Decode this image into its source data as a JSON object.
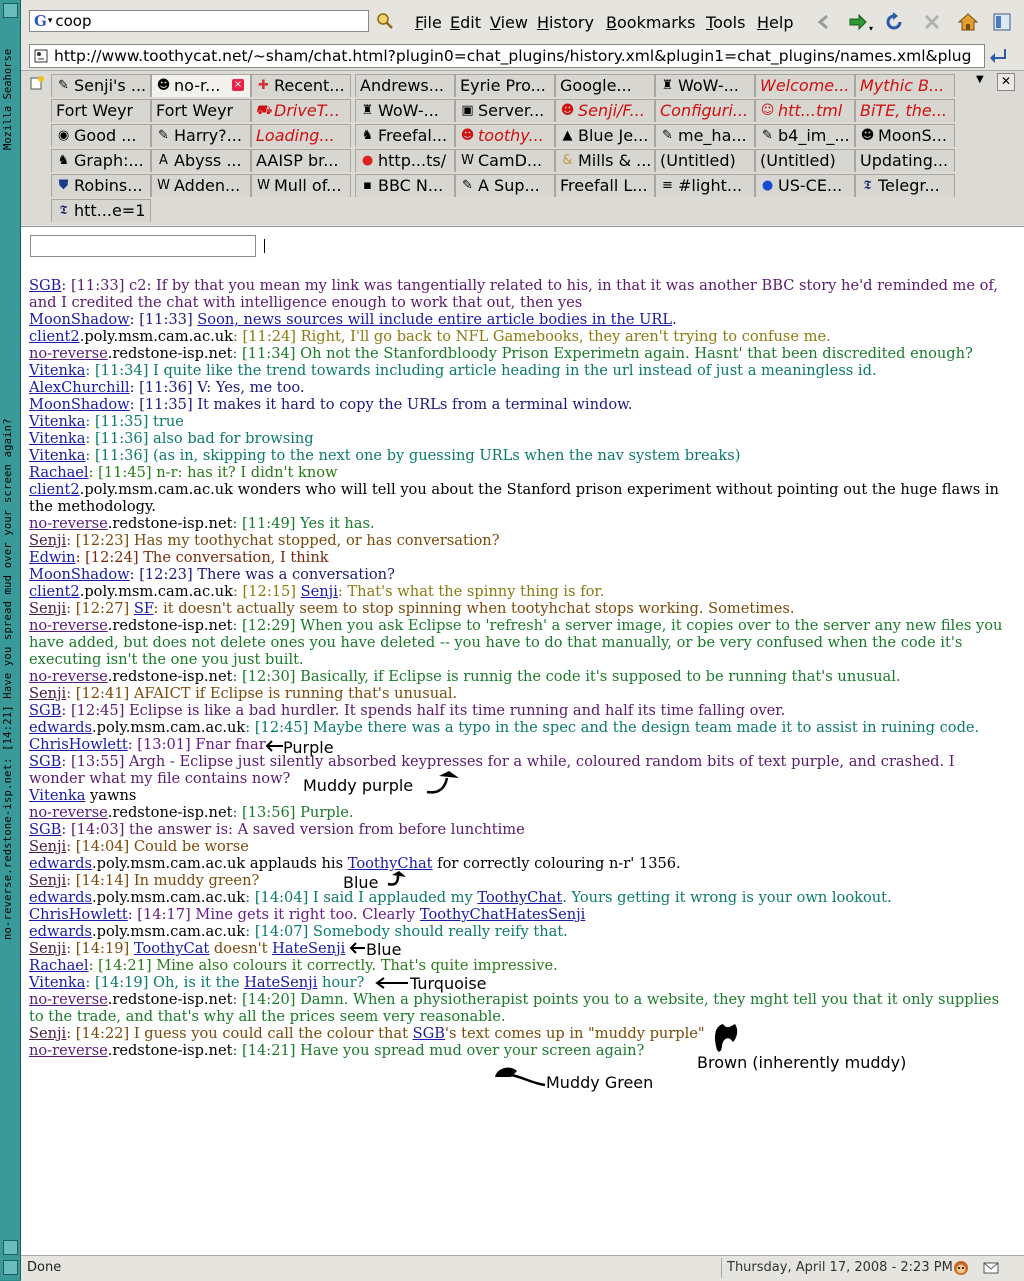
{
  "window": {
    "sidebar_title": "no-reverse.redstone-isp.net: [14:21] Have you spread mud over your screen again?",
    "sidebar_app": "Mozilla Seahorse"
  },
  "menubar": {
    "search_value": "coop",
    "search_engine_glyph": "G",
    "items": [
      "File",
      "Edit",
      "View",
      "History",
      "Bookmarks",
      "Tools",
      "Help"
    ]
  },
  "urlbar": {
    "url": "http://www.toothycat.net/~sham/chat.html?plugin0=chat_plugins/history.xml&plugin1=chat_plugins/names.xml&plug"
  },
  "tabs": {
    "rows": [
      [
        {
          "label": "Senji's ...",
          "icon": "pencil-icon",
          "red": false
        },
        {
          "label": "no-r...",
          "icon": "toothy-icon",
          "red": false,
          "active": true,
          "closable": true
        },
        {
          "label": "Recent...",
          "icon": "compass-icon",
          "red": false
        },
        {
          "label": "Andrews...",
          "icon": "",
          "red": false
        },
        {
          "label": "Eyrie Pro...",
          "icon": "",
          "red": false
        },
        {
          "label": "Google...",
          "icon": "",
          "red": false
        },
        {
          "label": "WoW-...",
          "icon": "wow-icon",
          "red": false
        },
        {
          "label": "Welcome...",
          "icon": "",
          "red": true
        },
        {
          "label": "Mythic B...",
          "icon": "",
          "red": true
        }
      ],
      [
        {
          "label": "Fort Weyr",
          "icon": "",
          "red": false
        },
        {
          "label": "Fort Weyr",
          "icon": "",
          "red": false
        },
        {
          "label": "DriveT...",
          "icon": "car-icon",
          "red": true
        },
        {
          "label": "WoW-...",
          "icon": "wow-icon",
          "red": false
        },
        {
          "label": "Server...",
          "icon": "server-icon",
          "red": false
        },
        {
          "label": "Senji/F...",
          "icon": "toothy-icon",
          "red": true
        },
        {
          "label": "Configuri...",
          "icon": "",
          "red": true
        },
        {
          "label": "htt...tml",
          "icon": "smiley-icon",
          "red": true
        },
        {
          "label": "BiTE, the...",
          "icon": "",
          "red": true
        }
      ],
      [
        {
          "label": "Good ...",
          "icon": "chat-icon",
          "red": false
        },
        {
          "label": "Harry?...",
          "icon": "pencil-icon",
          "red": false
        },
        {
          "label": "Loading...",
          "icon": "",
          "red": true
        },
        {
          "label": "Freefal...",
          "icon": "freefall-icon",
          "red": false
        },
        {
          "label": "toothy...",
          "icon": "toothy-icon",
          "red": true
        },
        {
          "label": "Blue Je...",
          "icon": "mountain-icon",
          "red": false
        },
        {
          "label": "me_ha...",
          "icon": "pencil-icon",
          "red": false
        },
        {
          "label": "b4_im_...",
          "icon": "pencil-icon",
          "red": false
        },
        {
          "label": "MoonS...",
          "icon": "toothy-icon",
          "red": false
        }
      ],
      [
        {
          "label": "Graph:...",
          "icon": "camel-icon",
          "red": false
        },
        {
          "label": "Abyss ...",
          "icon": "abyss-icon",
          "red": false
        },
        {
          "label": "AAISP br...",
          "icon": "",
          "red": false
        },
        {
          "label": "http...ts/",
          "icon": "color-ball-icon",
          "red": false
        },
        {
          "label": "CamD...",
          "icon": "camd-icon",
          "red": false
        },
        {
          "label": "Mills & ...",
          "icon": "ampersand-icon",
          "red": false
        },
        {
          "label": "(Untitled)",
          "icon": "",
          "red": false
        },
        {
          "label": "(Untitled)",
          "icon": "",
          "red": false
        },
        {
          "label": "Updating...",
          "icon": "",
          "red": false
        }
      ],
      [
        {
          "label": "Robins...",
          "icon": "shield-icon",
          "red": false
        },
        {
          "label": "Adden...",
          "icon": "wikipedia-icon",
          "red": false
        },
        {
          "label": "Mull of...",
          "icon": "wikipedia-icon",
          "red": false
        },
        {
          "label": "BBC N...",
          "icon": "bbc-icon",
          "red": false
        },
        {
          "label": "A Sup...",
          "icon": "pencil-icon",
          "red": false
        },
        {
          "label": "Freefall L...",
          "icon": "",
          "red": false
        },
        {
          "label": "#light...",
          "icon": "irc-icon",
          "red": false
        },
        {
          "label": "US-CE...",
          "icon": "blue-dot-icon",
          "red": false
        },
        {
          "label": "Telegr...",
          "icon": "telegraph-icon",
          "red": false
        }
      ],
      [
        {
          "label": "htt...e=1",
          "icon": "telegraph-icon",
          "red": false
        }
      ]
    ]
  },
  "chat": {
    "input_value": "",
    "messages": [
      {
        "segs": [
          {
            "t": "SGB",
            "nick": true
          },
          {
            "t": ": [11:33] c2: If by that you mean my link was tangentially related to his, in that it was another BBC story he'd reminded me of, and I credited the chat with intelligence enough to work that out, then yes"
          }
        ],
        "color": "#5a1a6e"
      },
      {
        "segs": [
          {
            "t": "MoonShadow",
            "nick": true
          },
          {
            "t": ": [11:33] "
          },
          {
            "t": "Soon, news sources will include entire article bodies in the URL",
            "link": true
          },
          {
            "t": "."
          }
        ],
        "color": "#1a1a7a"
      },
      {
        "segs": [
          {
            "t": "client2",
            "nick": true
          },
          {
            "t": ".poly.msm.cam.ac.uk",
            "plain": true
          },
          {
            "t": ": [11:24] Right, I'll go back to NFL Gamebooks, they aren't trying to confuse me."
          }
        ],
        "color": "#8a7a10"
      },
      {
        "segs": [
          {
            "t": "no-reverse",
            "nick": true,
            "cls": "purple"
          },
          {
            "t": ".redstone-isp.net",
            "plain": true
          },
          {
            "t": ": [11:34] Oh not the Stanfordbloody Prison Experimetn again. Hasnt' that been discredited enough?"
          }
        ],
        "color": "#1a7a2a"
      },
      {
        "segs": [
          {
            "t": "Vitenka",
            "nick": true
          },
          {
            "t": ": [11:34] I quite like the trend towards including article heading in the url instead of just a meaningless id."
          }
        ],
        "color": "#0a7a6a"
      },
      {
        "segs": [
          {
            "t": "AlexChurchill",
            "nick": true
          },
          {
            "t": ": [11:36] V: Yes, me too."
          }
        ],
        "color": "#1a1a7a"
      },
      {
        "segs": [
          {
            "t": "MoonShadow",
            "nick": true
          },
          {
            "t": ": [11:35] It makes it hard to copy the URLs from a terminal window."
          }
        ],
        "color": "#1a1a7a"
      },
      {
        "segs": [
          {
            "t": "Vitenka",
            "nick": true
          },
          {
            "t": ": [11:35] true"
          }
        ],
        "color": "#0a7a6a"
      },
      {
        "segs": [
          {
            "t": "Vitenka",
            "nick": true
          },
          {
            "t": ": [11:36] also bad for browsing"
          }
        ],
        "color": "#0a7a6a"
      },
      {
        "segs": [
          {
            "t": "Vitenka",
            "nick": true
          },
          {
            "t": ": [11:36] (as in, skipping to the next one by guessing URLs when the nav system breaks)"
          }
        ],
        "color": "#0a7a6a"
      },
      {
        "segs": [
          {
            "t": "Rachael",
            "nick": true
          },
          {
            "t": ": [11:45] n-r: has it? I didn't know"
          }
        ],
        "color": "#2a7a1a"
      },
      {
        "segs": [
          {
            "t": "client2",
            "nick": true
          },
          {
            "t": ".poly.msm.cam.ac.uk wonders who will tell you about the Stanford prison experiment without pointing out the huge flaws in the methodology."
          }
        ],
        "color": "#000000"
      },
      {
        "segs": [
          {
            "t": "no-reverse",
            "nick": true,
            "cls": "purple"
          },
          {
            "t": ".redstone-isp.net",
            "plain": true
          },
          {
            "t": ": [11:49] Yes it has."
          }
        ],
        "color": "#1a7a2a"
      },
      {
        "segs": [
          {
            "t": "Senji",
            "nick": true,
            "cls": "dark"
          },
          {
            "t": ": [12:23] Has my toothychat stopped, or has conversation?"
          }
        ],
        "color": "#7a4a0a"
      },
      {
        "segs": [
          {
            "t": "Edwin",
            "nick": true
          },
          {
            "t": ": [12:24] The conversation, I think"
          }
        ],
        "color": "#7a2a0a"
      },
      {
        "segs": [
          {
            "t": "MoonShadow",
            "nick": true
          },
          {
            "t": ": [12:23] There was a conversation?"
          }
        ],
        "color": "#1a1a7a"
      },
      {
        "segs": [
          {
            "t": "client2",
            "nick": true
          },
          {
            "t": ".poly.msm.cam.ac.uk",
            "plain": true
          },
          {
            "t": ": [12:15] "
          },
          {
            "t": "Senji",
            "link": true
          },
          {
            "t": ": That's what the spinny thing is for."
          }
        ],
        "color": "#8a7a10"
      },
      {
        "segs": [
          {
            "t": "Senji",
            "nick": true,
            "cls": "dark"
          },
          {
            "t": ": [12:27] "
          },
          {
            "t": "SF",
            "link": true
          },
          {
            "t": ": it doesn't actually seem to stop spinning when tootyhchat stops working. Sometimes."
          }
        ],
        "color": "#7a4a0a"
      },
      {
        "segs": [
          {
            "t": "no-reverse",
            "nick": true,
            "cls": "purple"
          },
          {
            "t": ".redstone-isp.net",
            "plain": true
          },
          {
            "t": ": [12:29] When you ask Eclipse to 'refresh' a server image, it copies over to the server any new files you have added, but does not delete ones you have deleted -- you have to do that manually, or be very confused when the code it's executing isn't the one you just built."
          }
        ],
        "color": "#1a7a2a"
      },
      {
        "segs": [
          {
            "t": "no-reverse",
            "nick": true,
            "cls": "purple"
          },
          {
            "t": ".redstone-isp.net",
            "plain": true
          },
          {
            "t": ": [12:30] Basically, if Eclipse is runnig the code it's supposed to be running that's unusual."
          }
        ],
        "color": "#1a7a2a"
      },
      {
        "segs": [
          {
            "t": "Senji",
            "nick": true,
            "cls": "dark"
          },
          {
            "t": ": [12:41] AFAICT if Eclipse is running that's unusual."
          }
        ],
        "color": "#7a4a0a"
      },
      {
        "segs": [
          {
            "t": "SGB",
            "nick": true
          },
          {
            "t": ": [12:45] Eclipse is like a bad hurdler. It spends half its time running and half its time falling over."
          }
        ],
        "color": "#5a1a6e"
      },
      {
        "segs": [
          {
            "t": "edwards",
            "nick": true
          },
          {
            "t": ".poly.msm.cam.ac.uk",
            "plain": true
          },
          {
            "t": ": [12:45] Maybe there was a typo in the spec and the design team made it to assist in ruining code."
          }
        ],
        "color": "#0a7a6a"
      },
      {
        "segs": [
          {
            "t": "ChrisHowlett",
            "nick": true
          },
          {
            "t": ": [13:01] Fnar fnar"
          }
        ],
        "color": "#6a1a8a"
      },
      {
        "segs": [
          {
            "t": "SGB",
            "nick": true
          },
          {
            "t": ": [13:55] Argh - Eclipse just silently absorbed keypresses for a while, coloured random bits of text purple, and crashed. I wonder what my file contains now?"
          }
        ],
        "color": "#5a1a6e"
      },
      {
        "segs": [
          {
            "t": "Vitenka",
            "nick": true
          },
          {
            "t": " yawns"
          }
        ],
        "color": "#000000"
      },
      {
        "segs": [
          {
            "t": "no-reverse",
            "nick": true,
            "cls": "purple"
          },
          {
            "t": ".redstone-isp.net",
            "plain": true
          },
          {
            "t": ": [13:56] Purple."
          }
        ],
        "color": "#1a7a2a"
      },
      {
        "segs": [
          {
            "t": "SGB",
            "nick": true
          },
          {
            "t": ": [14:03] the answer is: A saved version from before lunchtime"
          }
        ],
        "color": "#5a1a6e"
      },
      {
        "segs": [
          {
            "t": "Senji",
            "nick": true,
            "cls": "dark"
          },
          {
            "t": ": [14:04] Could be worse"
          }
        ],
        "color": "#7a4a0a"
      },
      {
        "segs": [
          {
            "t": "edwards",
            "nick": true
          },
          {
            "t": ".poly.msm.cam.ac.uk applauds his "
          },
          {
            "t": "ToothyChat",
            "link": true
          },
          {
            "t": " for correctly colouring n-r' 1356."
          }
        ],
        "color": "#000000"
      },
      {
        "segs": [
          {
            "t": "Senji",
            "nick": true,
            "cls": "dark"
          },
          {
            "t": ": [14:14] In muddy green?"
          }
        ],
        "color": "#7a4a0a"
      },
      {
        "segs": [
          {
            "t": "edwards",
            "nick": true
          },
          {
            "t": ".poly.msm.cam.ac.uk",
            "plain": true
          },
          {
            "t": ": [14:04] I said I applauded my "
          },
          {
            "t": "ToothyChat",
            "link": true
          },
          {
            "t": ". Yours getting it wrong is your own lookout."
          }
        ],
        "color": "#0a7a6a"
      },
      {
        "segs": [
          {
            "t": "ChrisHowlett",
            "nick": true
          },
          {
            "t": ": [14:17] Mine gets it right too. Clearly "
          },
          {
            "t": "ToothyChatHatesSenji",
            "link": true
          }
        ],
        "color": "#6a1a8a"
      },
      {
        "segs": [
          {
            "t": "edwards",
            "nick": true
          },
          {
            "t": ".poly.msm.cam.ac.uk",
            "plain": true
          },
          {
            "t": ": [14:07] Somebody should really reify that."
          }
        ],
        "color": "#0a7a6a"
      },
      {
        "segs": [
          {
            "t": "Senji",
            "nick": true,
            "cls": "dark"
          },
          {
            "t": ": [14:19] "
          },
          {
            "t": "ToothyCat",
            "link": true
          },
          {
            "t": " doesn't "
          },
          {
            "t": "HateSenji",
            "link": true
          }
        ],
        "color": "#7a4a0a"
      },
      {
        "segs": [
          {
            "t": "Rachael",
            "nick": true
          },
          {
            "t": ": [14:21] Mine also colours it correctly. That's quite impressive."
          }
        ],
        "color": "#2a7a1a"
      },
      {
        "segs": [
          {
            "t": "Vitenka",
            "nick": true
          },
          {
            "t": ": [14:19] Oh, is it the "
          },
          {
            "t": "HateSenji",
            "link": true
          },
          {
            "t": " hour?"
          }
        ],
        "color": "#0a7a6a"
      },
      {
        "segs": [
          {
            "t": "no-reverse",
            "nick": true,
            "cls": "purple"
          },
          {
            "t": ".redstone-isp.net",
            "plain": true
          },
          {
            "t": ": [14:20] Damn. When a physiotherapist points you to a website, they mght tell you that it only supplies to the trade, and that's why all the prices seem very reasonable."
          }
        ],
        "color": "#1a7a2a"
      },
      {
        "segs": [
          {
            "t": "Senji",
            "nick": true,
            "cls": "dark"
          },
          {
            "t": ": [14:22] I guess you could call the colour that "
          },
          {
            "t": "SGB",
            "link": true
          },
          {
            "t": "'s text comes up in \"muddy purple\""
          }
        ],
        "color": "#7a4a0a"
      },
      {
        "segs": [
          {
            "t": "no-reverse",
            "nick": true,
            "cls": "purple"
          },
          {
            "t": ".redstone-isp.net",
            "plain": true
          },
          {
            "t": ": [14:21] Have you spread mud over your screen again?"
          }
        ],
        "color": "#1a7a2a"
      }
    ],
    "annotations": {
      "purple": "Purple",
      "muddy_purple": "Muddy purple",
      "blue1": "Blue",
      "blue2": "Blue",
      "turquoise": "Turquoise",
      "brown": "Brown (inherently muddy)",
      "muddy_green": "Muddy Green"
    }
  },
  "statusbar": {
    "status": "Done",
    "datetime": "Thursday, April 17, 2008 - 2:23 PM"
  }
}
